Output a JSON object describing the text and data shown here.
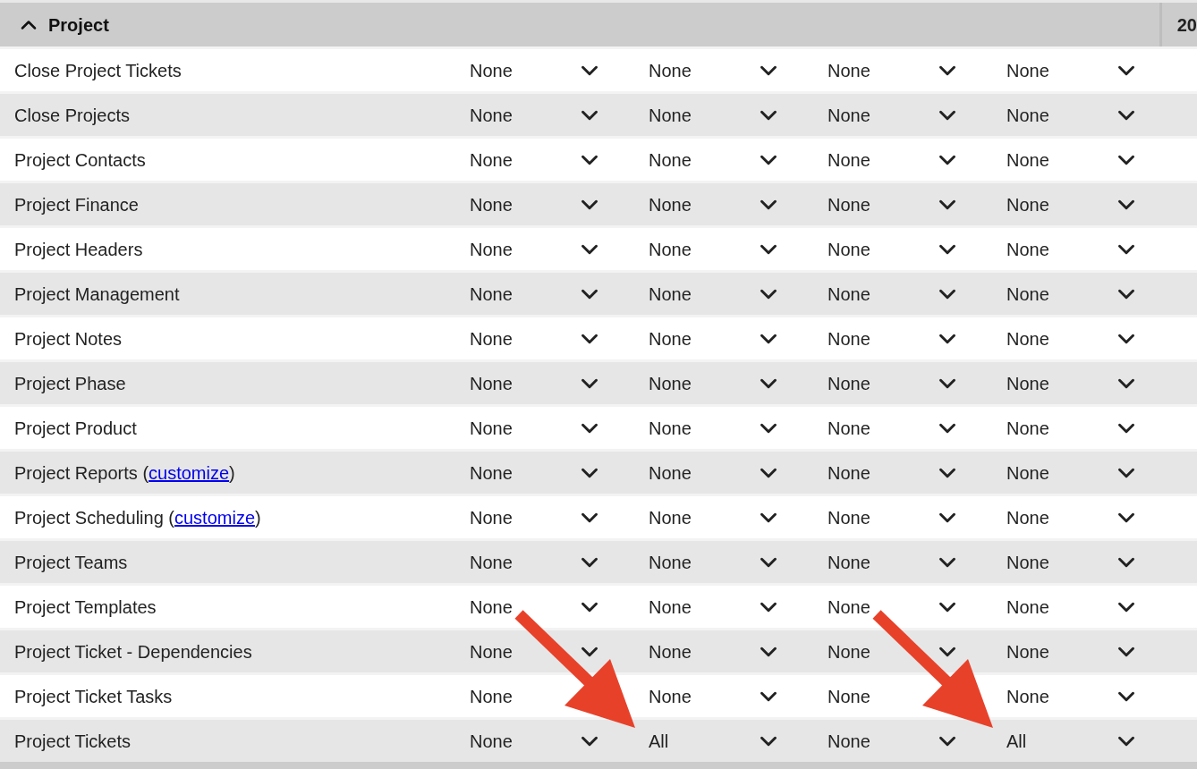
{
  "section": {
    "title": "Project",
    "expanded": true,
    "next_column_header": "20"
  },
  "rows": [
    {
      "label": "Close Project Tickets",
      "cells": [
        {
          "value": "None",
          "arrow": false
        },
        {
          "value": "None",
          "arrow": false
        },
        {
          "value": "None",
          "arrow": false
        },
        {
          "value": "None",
          "arrow": false
        }
      ]
    },
    {
      "label": "Close Projects",
      "cells": [
        {
          "value": "None",
          "arrow": false
        },
        {
          "value": "None",
          "arrow": false
        },
        {
          "value": "None",
          "arrow": false
        },
        {
          "value": "None",
          "arrow": false
        }
      ]
    },
    {
      "label": "Project Contacts",
      "cells": [
        {
          "value": "None",
          "arrow": false
        },
        {
          "value": "None",
          "arrow": false
        },
        {
          "value": "None",
          "arrow": false
        },
        {
          "value": "None",
          "arrow": false
        }
      ]
    },
    {
      "label": "Project Finance",
      "cells": [
        {
          "value": "None",
          "arrow": false
        },
        {
          "value": "None",
          "arrow": false
        },
        {
          "value": "None",
          "arrow": false
        },
        {
          "value": "None",
          "arrow": false
        }
      ]
    },
    {
      "label": "Project Headers",
      "cells": [
        {
          "value": "None",
          "arrow": false
        },
        {
          "value": "None",
          "arrow": false
        },
        {
          "value": "None",
          "arrow": false
        },
        {
          "value": "None",
          "arrow": false
        }
      ]
    },
    {
      "label": "Project Management",
      "cells": [
        {
          "value": "None",
          "arrow": false
        },
        {
          "value": "None",
          "arrow": false
        },
        {
          "value": "None",
          "arrow": false
        },
        {
          "value": "None",
          "arrow": false
        }
      ]
    },
    {
      "label": "Project Notes",
      "cells": [
        {
          "value": "None",
          "arrow": false
        },
        {
          "value": "None",
          "arrow": false
        },
        {
          "value": "None",
          "arrow": false
        },
        {
          "value": "None",
          "arrow": false
        }
      ]
    },
    {
      "label": "Project Phase",
      "cells": [
        {
          "value": "None",
          "arrow": false
        },
        {
          "value": "None",
          "arrow": false
        },
        {
          "value": "None",
          "arrow": false
        },
        {
          "value": "None",
          "arrow": false
        }
      ]
    },
    {
      "label": "Project Product",
      "cells": [
        {
          "value": "None",
          "arrow": false
        },
        {
          "value": "None",
          "arrow": false
        },
        {
          "value": "None",
          "arrow": false
        },
        {
          "value": "None",
          "arrow": false
        }
      ]
    },
    {
      "label": "Project Reports (",
      "link": "customize",
      "label_after": ")",
      "cells": [
        {
          "value": "None",
          "arrow": false
        },
        {
          "value": "None",
          "arrow": false
        },
        {
          "value": "None",
          "arrow": false
        },
        {
          "value": "None",
          "arrow": false
        }
      ]
    },
    {
      "label": "Project Scheduling (",
      "link": "customize",
      "label_after": ")",
      "cells": [
        {
          "value": "None",
          "arrow": false
        },
        {
          "value": "None",
          "arrow": false
        },
        {
          "value": "None",
          "arrow": false
        },
        {
          "value": "None",
          "arrow": false
        }
      ]
    },
    {
      "label": "Project Teams",
      "cells": [
        {
          "value": "None",
          "arrow": false
        },
        {
          "value": "None",
          "arrow": false
        },
        {
          "value": "None",
          "arrow": false
        },
        {
          "value": "None",
          "arrow": false
        }
      ]
    },
    {
      "label": "Project Templates",
      "cells": [
        {
          "value": "None",
          "arrow": false
        },
        {
          "value": "None",
          "arrow": false
        },
        {
          "value": "None",
          "arrow": false
        },
        {
          "value": "None",
          "arrow": false
        }
      ]
    },
    {
      "label": "Project Ticket - Dependencies",
      "cells": [
        {
          "value": "None",
          "arrow": false
        },
        {
          "value": "None",
          "arrow": false
        },
        {
          "value": "None",
          "arrow": false
        },
        {
          "value": "None",
          "arrow": false
        }
      ]
    },
    {
      "label": "Project Ticket Tasks",
      "cells": [
        {
          "value": "None",
          "arrow": false
        },
        {
          "value": "None",
          "arrow": false
        },
        {
          "value": "None",
          "arrow": false
        },
        {
          "value": "None",
          "arrow": false
        }
      ]
    },
    {
      "label": "Project Tickets",
      "cells": [
        {
          "value": "None",
          "arrow": false
        },
        {
          "value": "All",
          "arrow": true
        },
        {
          "value": "None",
          "arrow": false
        },
        {
          "value": "All",
          "arrow": true
        }
      ]
    }
  ]
}
